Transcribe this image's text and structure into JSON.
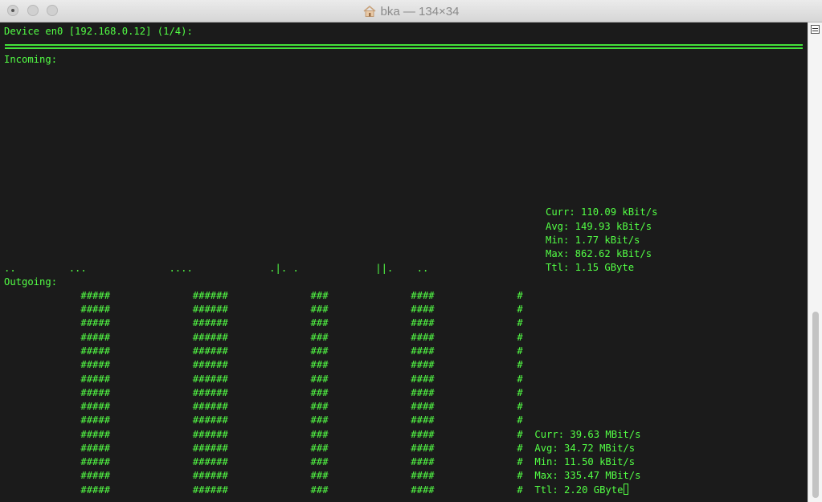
{
  "window": {
    "title": "bka — 134×34",
    "title_icon": "home-icon"
  },
  "terminal": {
    "header": "Device en0 [192.168.0.12] (1/4):",
    "separator": "================================================================================================================================================",
    "incoming_label": "Incoming:",
    "incoming_graph": "..         ...              ....             .|. .             ||.    ..",
    "incoming_stats": {
      "curr": "Curr: 110.09 kBit/s",
      "avg": "Avg: 149.93 kBit/s",
      "min": "Min: 1.77 kBit/s",
      "max": "Max: 862.62 kBit/s",
      "ttl": "Ttl: 1.15 GByte"
    },
    "outgoing_label": "Outgoing:",
    "outgoing_graph_rows": [
      "             #####              ######              ###              ####              #",
      "             #####              ######              ###              ####              #",
      "             #####              ######              ###              ####              #",
      "             #####              ######              ###              ####              #",
      "             #####              ######              ###              ####              #",
      "             #####              ######              ###              ####              #",
      "             #####              ######              ###              ####              #",
      "             #####              ######              ###              ####              #",
      "             #####              ######              ###              ####              #",
      "             #####              ######              ###              ####              #",
      "             #####              ######              ###              ####              #  Curr: 39.63 MBit/s",
      "             #####              ######              ###              ####              #  Avg: 34.72 MBit/s",
      "             #####              ######              ###              ####              #  Min: 11.50 kBit/s",
      "             #####              ######              ###              ####              #  Max: 335.47 MBit/s",
      "             #####              ######              ###              ####              #  Ttl: 2.20 GByte"
    ]
  },
  "colors": {
    "terminal_bg": "#1b1b1b",
    "terminal_fg": "#53ff45"
  }
}
